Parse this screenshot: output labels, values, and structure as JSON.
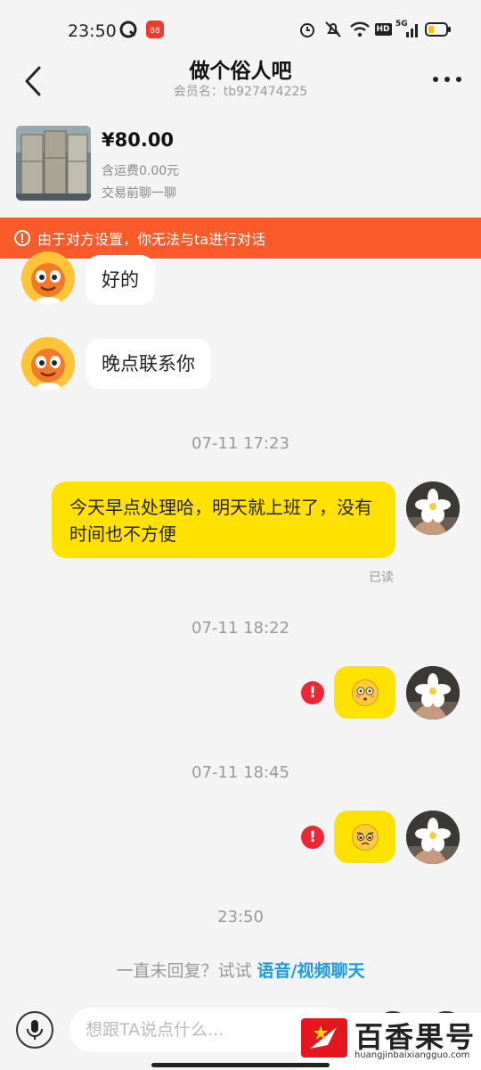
{
  "status_bar": {
    "time": "23:50",
    "icons": [
      "q-app-icon",
      "taobao-app-icon",
      "alarm-icon",
      "mute-icon",
      "wifi-icon",
      "hd-icon",
      "5g-signal-icon",
      "battery-icon"
    ],
    "hd_label": "HD",
    "network_label": "5G"
  },
  "header": {
    "title": "做个俗人吧",
    "member_label": "会员名：tb927474225"
  },
  "product": {
    "price": "¥80.00",
    "shipping": "含运费0.00元",
    "pre_chat": "交易前聊一聊"
  },
  "banner": {
    "text": "由于对方设置，你无法与ta进行对话",
    "color": "#fb5a2b"
  },
  "messages": {
    "incoming_1": "好的",
    "incoming_2": "晚点联系你",
    "time_1": "07-11 17:23",
    "outgoing_1": "今天早点处理哈，明天就上班了，没有时间也不方便",
    "read_status": "已读",
    "time_2": "07-11 18:22",
    "time_3": "07-11 18:45",
    "time_4": "23:50",
    "error_mark": "!"
  },
  "hint": {
    "text": "一直未回复？试试 ",
    "link": "语音/视频聊天"
  },
  "input": {
    "placeholder": "想跟TA说点什么..."
  },
  "watermark": {
    "name": "百香果号",
    "url": "huangjinbaixiangguo.com"
  },
  "colors": {
    "outgoing_bubble": "#ffe200",
    "link": "#1a9be6",
    "error": "#ee2737"
  }
}
